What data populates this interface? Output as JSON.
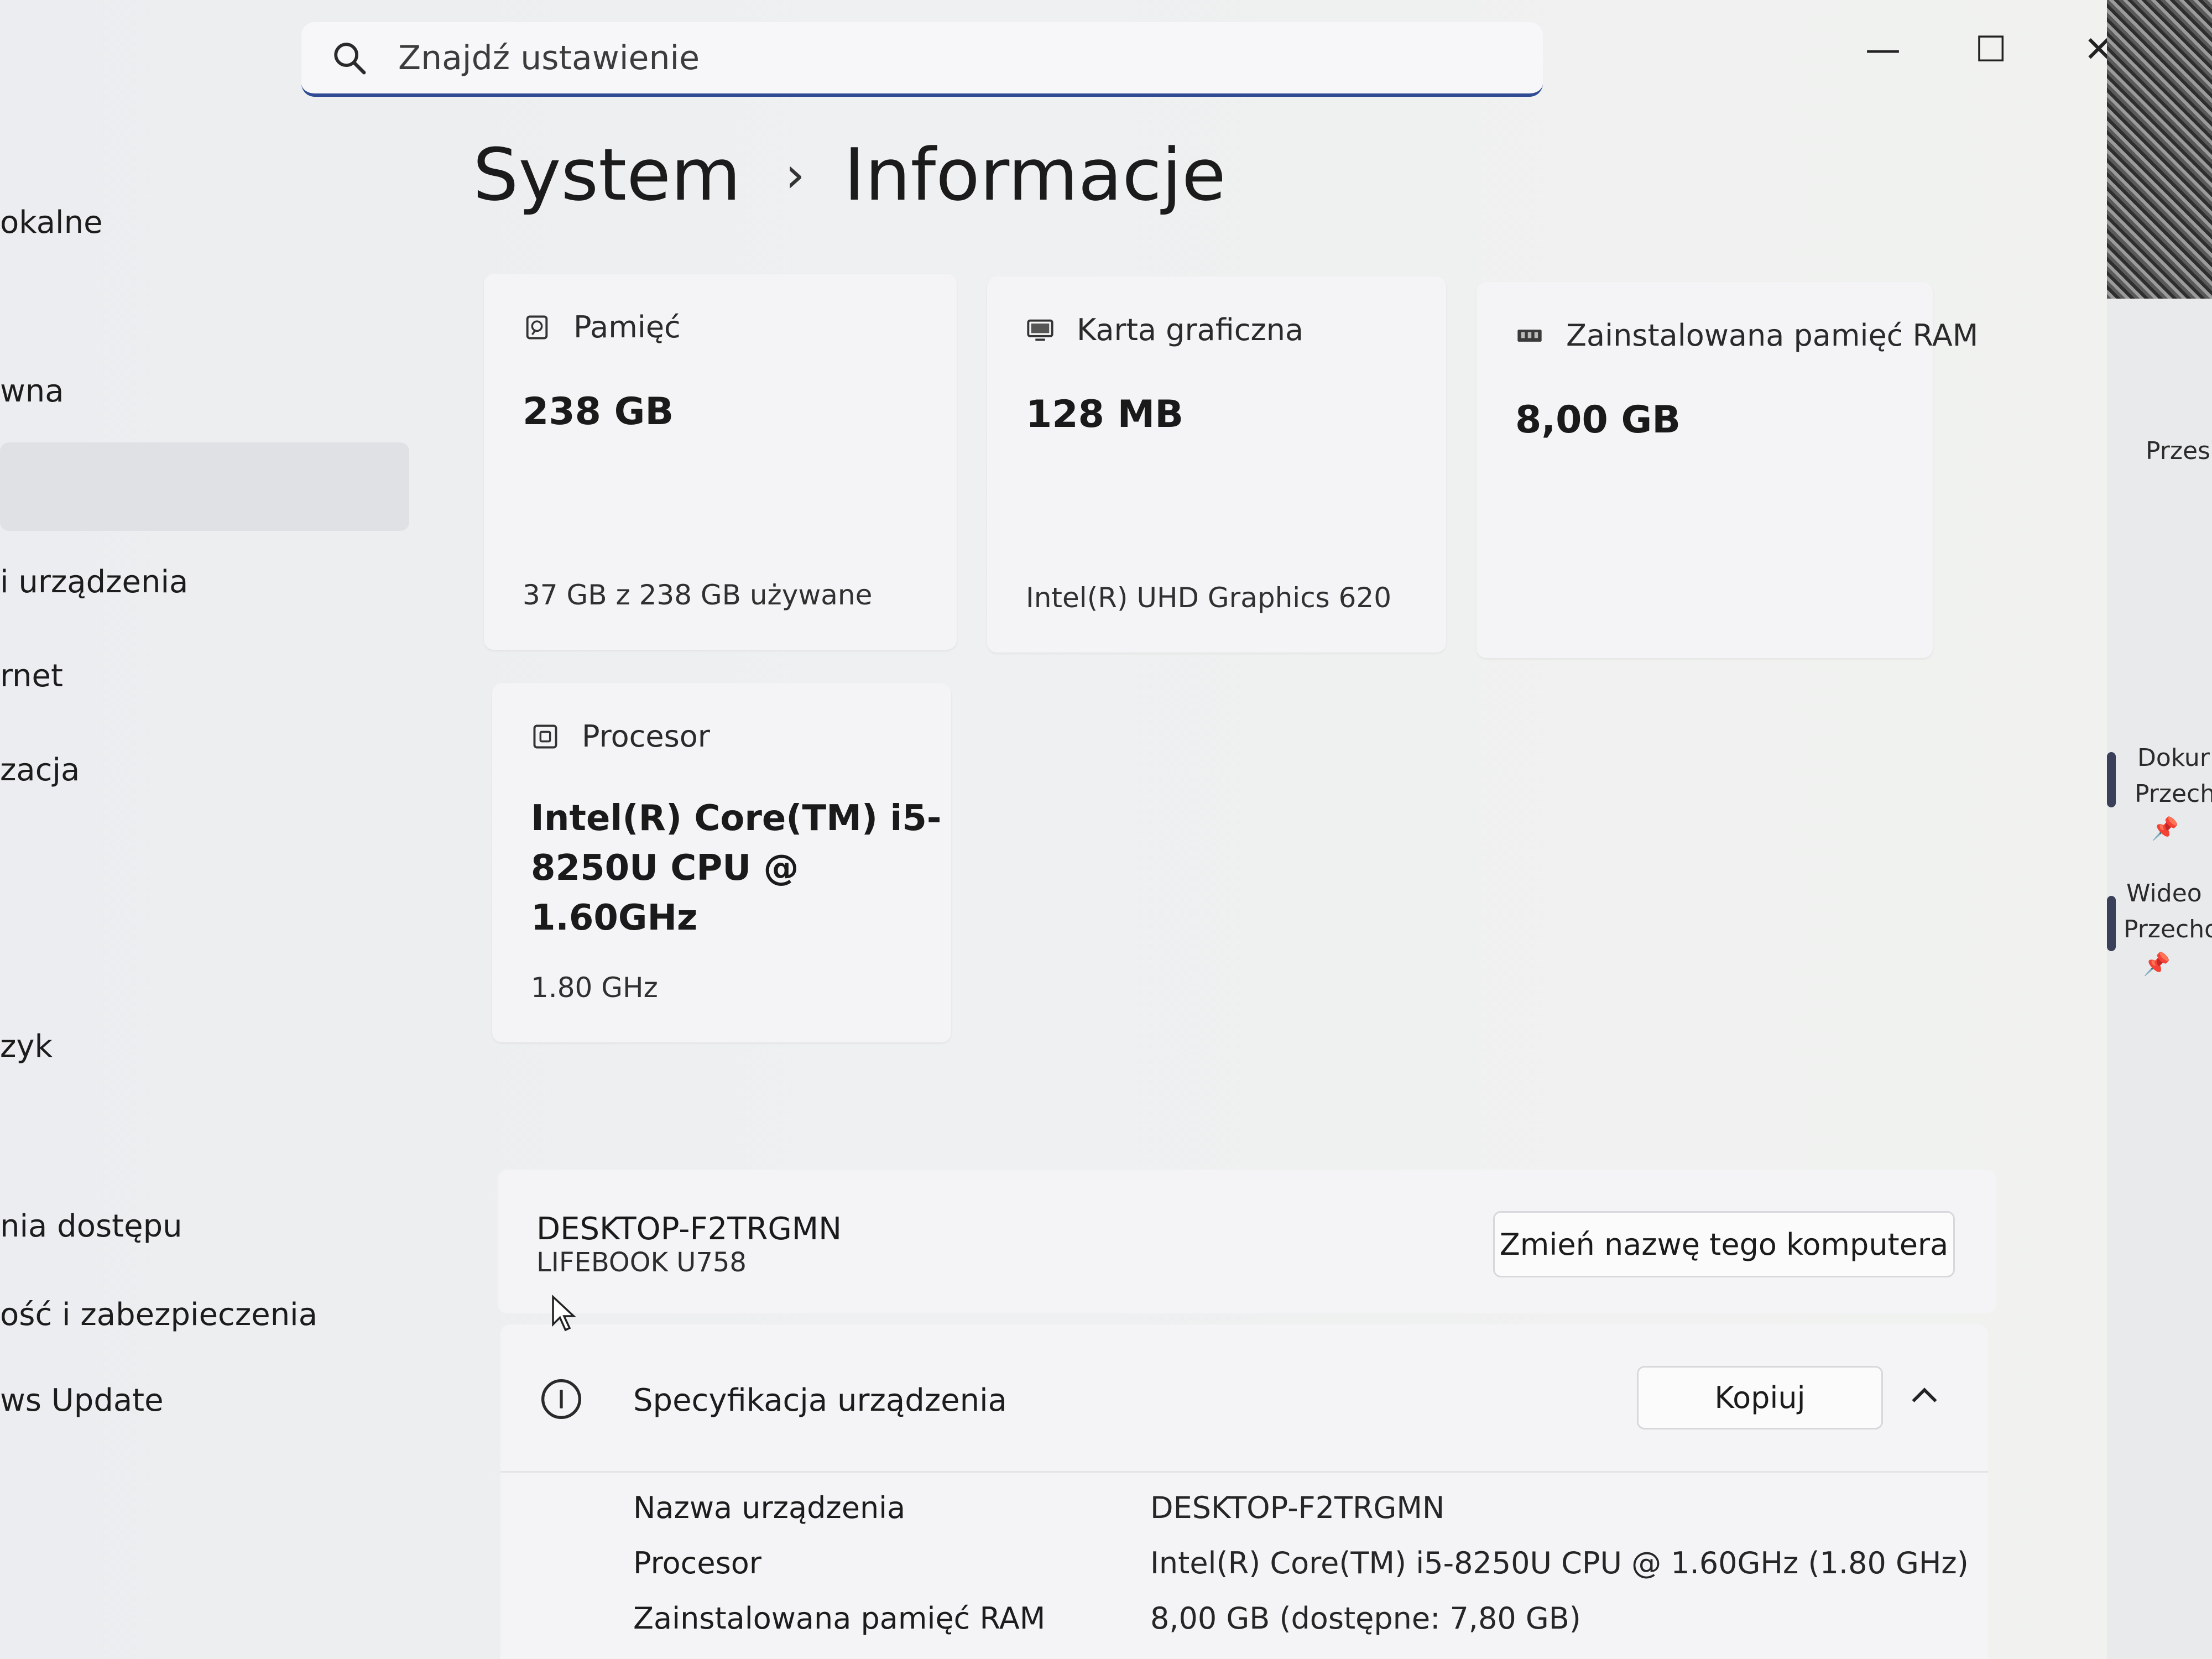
{
  "search": {
    "placeholder": "Znajdź ustawienie"
  },
  "window_controls": {
    "minimize": "—",
    "maximize": "☐",
    "close": "✕"
  },
  "nav": {
    "items": [
      "okalne",
      "wna",
      "i urządzenia",
      "rnet",
      "zacja",
      "zyk",
      "nia dostępu",
      "ość i zabezpieczenia",
      "ws Update"
    ]
  },
  "breadcrumb": {
    "parent": "System",
    "separator": "›",
    "current": "Informacje"
  },
  "cards": {
    "storage": {
      "label": "Pamięć",
      "value": "238 GB",
      "sub": "37 GB z 238 GB używane"
    },
    "gpu": {
      "label": "Karta graficzna",
      "value": "128 MB",
      "sub": "Intel(R) UHD Graphics 620"
    },
    "ram": {
      "label": "Zainstalowana pamięć RAM",
      "value": "8,00 GB"
    },
    "cpu": {
      "label": "Procesor",
      "value": "Intel(R) Core(TM) i5-8250U CPU @ 1.60GHz",
      "sub": "1.80 GHz"
    }
  },
  "device": {
    "name": "DESKTOP-F2TRGMN",
    "model": "LIFEBOOK U758",
    "rename_label": "Zmień nazwę tego komputera"
  },
  "specs": {
    "title": "Specyfikacja urządzenia",
    "copy_label": "Kopiuj",
    "rows": [
      {
        "label": "Nazwa urządzenia",
        "value": "DESKTOP-F2TRGMN"
      },
      {
        "label": "Procesor",
        "value": "Intel(R) Core(TM) i5-8250U CPU @ 1.60GHz (1.80 GHz)"
      },
      {
        "label": "Zainstalowana pamięć RAM",
        "value": "8,00 GB (dostępne: 7,80 GB)"
      }
    ]
  },
  "side_panel": {
    "items": [
      "Przes",
      "Dokur",
      "Przech",
      "Wideo",
      "Przecho"
    ]
  }
}
